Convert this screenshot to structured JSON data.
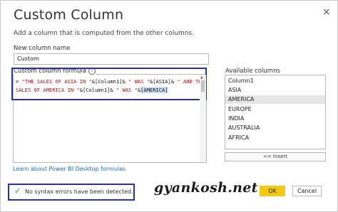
{
  "dialog": {
    "title": "Custom Column",
    "close_glyph": "×",
    "subtitle": "Add a column that is computed from the other columns."
  },
  "name_field": {
    "label": "New column name",
    "value": "Custom"
  },
  "formula": {
    "label": "Custom column formula",
    "info_glyph": "i",
    "line1_prefix": "= ",
    "line1_str1": "\"THE SALES OF ASIA IN \"",
    "line1_mid": "&[Column1]& ",
    "line1_str2": "\" WAS \"",
    "line1_mid2": "&[ASIA]& ",
    "line1_str3": "\" AND THE",
    "line2_str": "SALES OF AMERICA IN \"",
    "line2_mid": "&[Column1]& ",
    "line2_str2": "\" WAS \"",
    "line2_amp": "&",
    "line2_sel": "[AMERICA]"
  },
  "available_columns": {
    "label": "Available columns",
    "items": [
      "Column1",
      "ASIA",
      "AMERICA",
      "EUROPE",
      "INDIA",
      "AUSTRALIA",
      "AFRICA"
    ],
    "selected": "AMERICA",
    "insert_label": "<< Insert"
  },
  "learn_link": "Learn about Power BI Desktop formulas",
  "status": {
    "icon": "check-icon",
    "text": "No syntax errors have been detected."
  },
  "watermark": "gyankosh.net",
  "buttons": {
    "ok": "OK",
    "cancel": "Cancel"
  },
  "colors": {
    "ok_button": "#f2c811",
    "highlight_box": "#2b2fb3",
    "string_literal": "#a31515",
    "link": "#1a6fc9",
    "check": "#2a9a2a"
  }
}
